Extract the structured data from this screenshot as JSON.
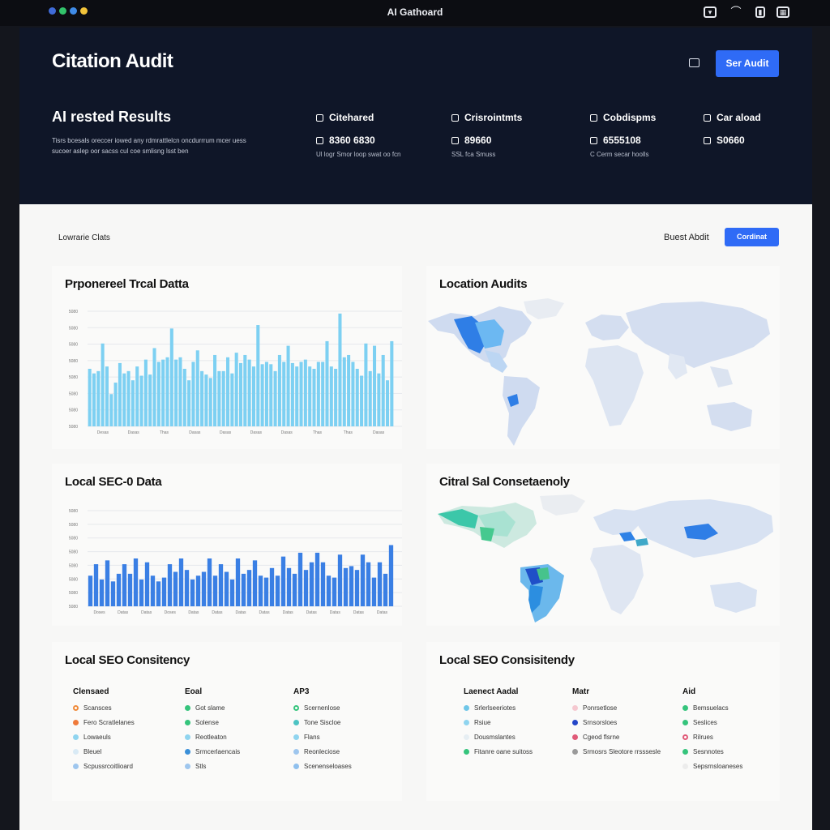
{
  "app": {
    "title": "AI Gathoard"
  },
  "window_dots": [
    "#3f6bd8",
    "#32c36b",
    "#3f8be8",
    "#f2c33a"
  ],
  "topbar_icons": [
    "wifi-icon",
    "signal-icon",
    "battery-icon",
    "menu-icon"
  ],
  "hero": {
    "title": "Citation Audit",
    "button_label": "Ser Audit",
    "results_title": "AI rested Results",
    "results_desc": "Tisrs bcesals oreccer iowed any rdmrattlelcn oncdurrrum mcer uess sucoer aslep oor sacss cul coe smlisng lsst ben",
    "stats": [
      {
        "label": "Citehared",
        "value": "8360 6830",
        "sub": "Ul logr Smor loop swat oo fcn"
      },
      {
        "label": "Crisrointmts",
        "value": "89660",
        "sub": "SSL fca Smuss"
      },
      {
        "label": "Cobdispms",
        "value": "6555108",
        "sub": "C Cerm secar hoolls"
      },
      {
        "label": "Car aload",
        "value": "S0660",
        "sub": ""
      }
    ]
  },
  "main": {
    "section_label": "Lowrarie Clats",
    "best_audit_label": "Buest Abdit",
    "button_label": "Cordinat"
  },
  "cards": {
    "chart1_title": "Prponereel Trcal Datta",
    "map1_title": "Location Audits",
    "chart2_title": "Local SEC-0 Data",
    "map2_title": "Citral Sal Consetaenoly",
    "legend1_title": "Local SEO Consitency",
    "legend2_title": "Local SEO Consisitendy"
  },
  "legend1": [
    {
      "head": "Clensaed",
      "items": [
        {
          "label": "Scansces",
          "color": "#ef8a3a",
          "ring": true
        },
        {
          "label": "Fero Scratlelanes",
          "color": "#ef7a3a",
          "ring": false
        },
        {
          "label": "Lowaeuls",
          "color": "#8fd4ef",
          "ring": false
        },
        {
          "label": "Bleuel",
          "color": "#d9eaf5",
          "ring": false
        },
        {
          "label": "Scpussrcoitlioard",
          "color": "#9ec6ee",
          "ring": false
        }
      ]
    },
    {
      "head": "Eoal",
      "items": [
        {
          "label": "Got slame",
          "color": "#35c47c",
          "ring": false
        },
        {
          "label": "Solense",
          "color": "#35c47c",
          "ring": false
        },
        {
          "label": "Reotleaton",
          "color": "#8fd4ef",
          "ring": false
        },
        {
          "label": "Srmcerlaencais",
          "color": "#3a8fd8",
          "ring": false
        },
        {
          "label": "Stls",
          "color": "#9ec6ee",
          "ring": false
        }
      ]
    },
    {
      "head": "AP3",
      "items": [
        {
          "label": "Scernenlose",
          "color": "#35c47c",
          "ring": true
        },
        {
          "label": "Tone Siscloe",
          "color": "#4cc3c3",
          "ring": false
        },
        {
          "label": "Flans",
          "color": "#8fd4ef",
          "ring": false
        },
        {
          "label": "Reonleciose",
          "color": "#9ec6ee",
          "ring": false
        },
        {
          "label": "Scenenseloases",
          "color": "#8fc0ee",
          "ring": false
        }
      ]
    }
  ],
  "legend2": [
    {
      "head": "Laenect Aadal",
      "items": [
        {
          "label": "Srlerlseeriotes",
          "color": "#6fc6e8",
          "ring": false
        },
        {
          "label": "Rsiue",
          "color": "#8fd4ef",
          "ring": false
        },
        {
          "label": "Dousmslantes",
          "color": "#e6eef3",
          "ring": false
        },
        {
          "label": "Fitanre oane suitoss",
          "color": "#35c47c",
          "ring": false
        }
      ]
    },
    {
      "head": "Matr",
      "items": [
        {
          "label": "Ponrsetlose",
          "color": "#f5c8d0",
          "ring": false
        },
        {
          "label": "Srnsorsloes",
          "color": "#2446c8",
          "ring": false
        },
        {
          "label": "Cgeod flsrne",
          "color": "#e05a78",
          "ring": false
        },
        {
          "label": "Srmosrs Sleotore rrsssesle",
          "color": "#9a9a9a",
          "ring": false
        }
      ]
    },
    {
      "head": "Aid",
      "items": [
        {
          "label": "Bemsuelacs",
          "color": "#35c47c",
          "ring": false
        },
        {
          "label": "Seslices",
          "color": "#35c47c",
          "ring": false
        },
        {
          "label": "Rilrues",
          "color": "#e05a78",
          "ring": true
        },
        {
          "label": "Sesnnotes",
          "color": "#35c47c",
          "ring": false
        },
        {
          "label": "Sepsrnsloaneses",
          "color": "#ececec",
          "ring": false
        }
      ]
    }
  ],
  "chart_data": [
    {
      "type": "bar",
      "title": "Prponereel Trcal Datta",
      "color": "#7dd0f2",
      "ytick_labels": [
        "5080",
        "5080",
        "5080",
        "5080",
        "5080",
        "5080",
        "5080",
        "5080"
      ],
      "xtick_labels": [
        "Desas",
        "Dasas",
        "Thas",
        "Dasas",
        "Dasas",
        "Dasas",
        "Dasas",
        "Thas",
        "Thas",
        "Dasas"
      ],
      "ylim": [
        0,
        100
      ],
      "values": [
        50,
        46,
        48,
        72,
        52,
        28,
        38,
        55,
        46,
        48,
        40,
        52,
        44,
        58,
        45,
        68,
        56,
        58,
        60,
        85,
        58,
        60,
        50,
        40,
        56,
        66,
        48,
        45,
        42,
        62,
        48,
        48,
        60,
        46,
        64,
        55,
        62,
        58,
        52,
        88,
        54,
        56,
        54,
        48,
        62,
        56,
        70,
        55,
        52,
        56,
        58,
        52,
        50,
        56,
        56,
        74,
        52,
        50,
        98,
        60,
        62,
        56,
        50,
        44,
        72,
        48,
        70,
        46,
        62,
        40,
        74
      ]
    },
    {
      "type": "bar",
      "title": "Local SEC-0 Data",
      "color": "#3a7fe4",
      "ytick_labels": [
        "5080",
        "5080",
        "5080",
        "5080",
        "5080",
        "5080",
        "5080",
        "5080"
      ],
      "xtick_labels": [
        "Doses",
        "Datas",
        "Datas",
        "Doses",
        "Datas",
        "Datas",
        "Datas",
        "Datas",
        "Datas",
        "Datas",
        "Datas",
        "Datas",
        "Datas"
      ],
      "ylim": [
        0,
        100
      ],
      "values": [
        32,
        44,
        28,
        48,
        26,
        34,
        44,
        34,
        50,
        28,
        46,
        32,
        26,
        30,
        44,
        36,
        50,
        38,
        28,
        32,
        36,
        50,
        32,
        44,
        36,
        28,
        50,
        34,
        38,
        48,
        32,
        30,
        40,
        32,
        52,
        40,
        34,
        56,
        38,
        46,
        56,
        46,
        32,
        30,
        54,
        40,
        42,
        38,
        54,
        46,
        30,
        46,
        34,
        64
      ]
    }
  ]
}
